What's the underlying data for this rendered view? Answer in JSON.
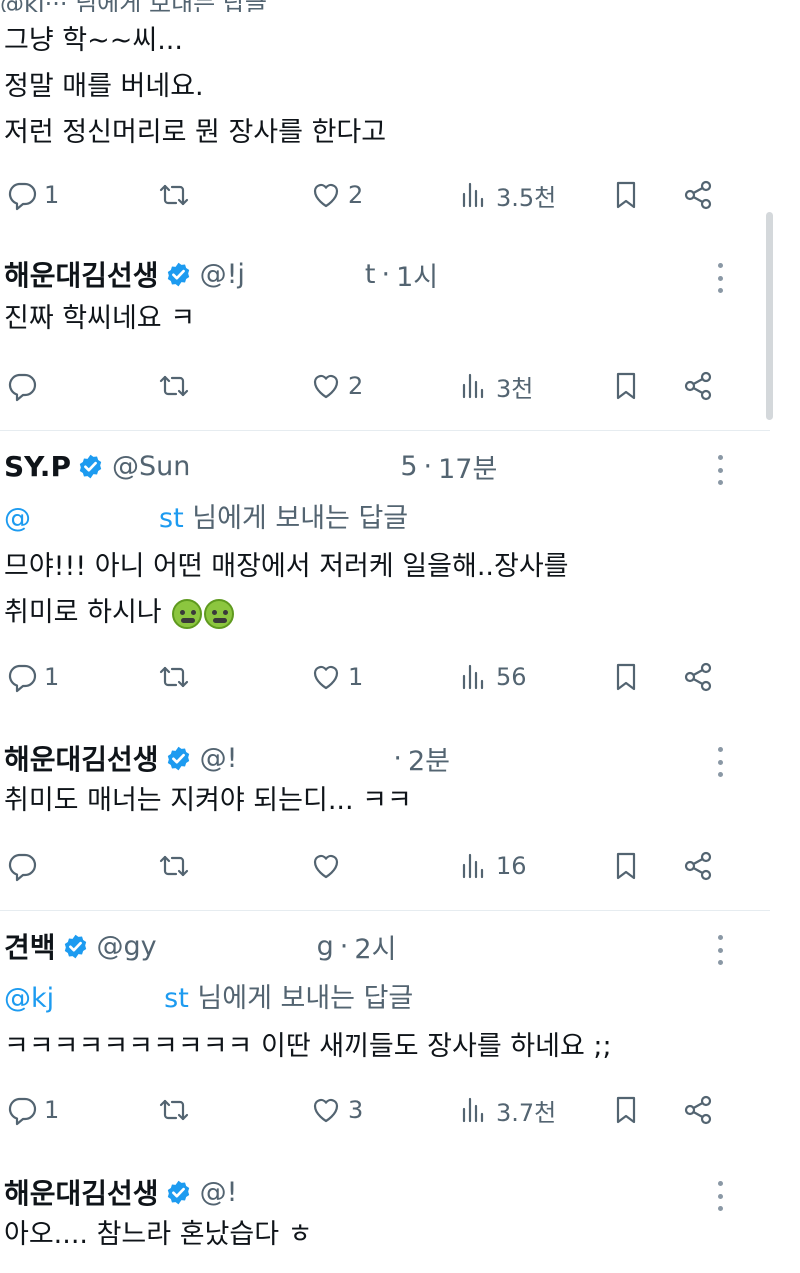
{
  "top_partial": "@kj··· 님에게 보내는 답글",
  "icons": {
    "reply": "reply-icon",
    "retweet": "retweet-icon",
    "like": "heart-icon",
    "views": "views-icon",
    "bookmark": "bookmark-icon",
    "share": "share-icon",
    "verified": "verified-badge-icon",
    "more": "more-icon"
  },
  "colors": {
    "accent": "#1d9bf0",
    "muted": "#536471",
    "text": "#0f1419"
  },
  "tweets": [
    {
      "text_lines": [
        "그냥 학~~씨...",
        "정말 매를 버네요.",
        "저런 정신머리로 뭔 장사를 한다고"
      ],
      "replies": "1",
      "retweets": "",
      "likes": "2",
      "views": "3.5천"
    },
    {
      "name": "해운대김선생",
      "handle": "@!j",
      "handle_tail": "t",
      "time": "1시",
      "text_lines": [
        "진짜 학씨네요 ㅋ"
      ],
      "replies": "",
      "retweets": "",
      "likes": "2",
      "views": "3천"
    },
    {
      "name": "SY.P",
      "handle": "@Sun",
      "handle_tail": "5",
      "time": "17분",
      "reply_to_mention": "@",
      "reply_to_mention_tail": "st",
      "reply_to_rest": "님에게 보내는 답글",
      "text_lines": [
        "므야!!! 아니 어떤 매장에서 저러케 일을해..장사를",
        "취미로 하시나"
      ],
      "replies": "1",
      "retweets": "",
      "likes": "1",
      "views": "56"
    },
    {
      "name": "해운대김선생",
      "handle": "@!",
      "handle_tail": "",
      "time": "2분",
      "text_lines": [
        "취미도 매너는 지켜야 되는디... ㅋㅋ"
      ],
      "replies": "",
      "retweets": "",
      "likes": "",
      "views": "16"
    },
    {
      "name": "견백",
      "handle": "@gy",
      "handle_tail": "g",
      "time": "2시",
      "reply_to_mention": "@kj",
      "reply_to_mention_tail": "st",
      "reply_to_rest": "님에게 보내는 답글",
      "text_lines": [
        "ㅋㅋㅋㅋㅋㅋㅋㅋㅋㅋ 이딴 새끼들도 장사를 하네요 ;;"
      ],
      "replies": "1",
      "retweets": "",
      "likes": "3",
      "views": "3.7천"
    },
    {
      "name": "해운대김선생",
      "handle": "@!",
      "handle_tail": "",
      "time": "",
      "text_lines": [
        "아오.... 참느라 혼났습다 ㅎ"
      ]
    }
  ],
  "emoji": [
    "nauseated-face-emoji",
    "nauseated-face-emoji"
  ]
}
